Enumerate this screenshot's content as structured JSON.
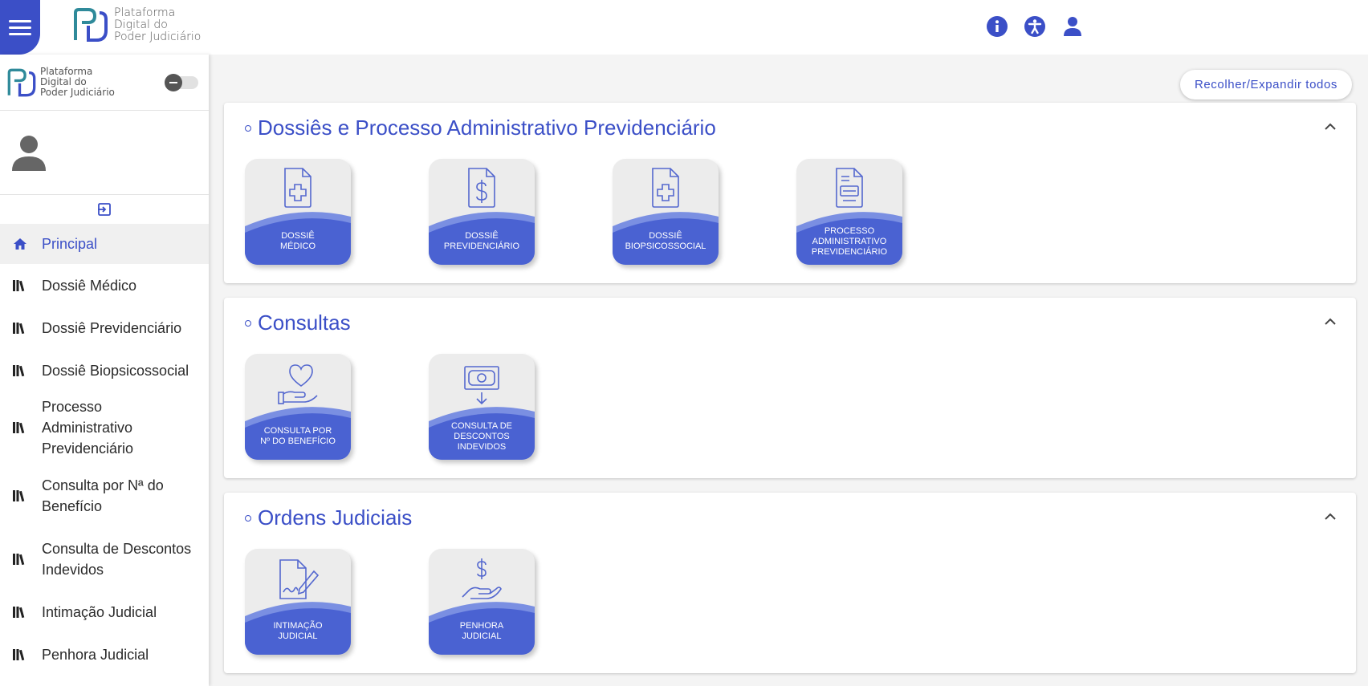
{
  "header": {
    "logo_lines": [
      "Plataforma",
      "Digital do",
      "Poder Judiciário"
    ],
    "icons": [
      "info-icon",
      "accessibility-icon",
      "user-icon"
    ]
  },
  "sidebar": {
    "logo_lines": [
      "Plataforma",
      "Digital do",
      "Poder Judiciário"
    ],
    "items": [
      {
        "label": "Principal",
        "icon": "home-icon",
        "active": true
      },
      {
        "label": "Dossiê Médico",
        "icon": "library-icon"
      },
      {
        "label": "Dossiê Previdenciário",
        "icon": "library-icon"
      },
      {
        "label": "Dossiê Biopsicossocial",
        "icon": "library-icon"
      },
      {
        "label": "Processo Administrativo Previdenciário",
        "icon": "library-icon"
      },
      {
        "label": "Consulta por Nª do Benefício",
        "icon": "library-icon"
      },
      {
        "label": "Consulta de Descontos Indevidos",
        "icon": "library-icon"
      },
      {
        "label": "Intimação Judicial",
        "icon": "library-icon"
      },
      {
        "label": "Penhora Judicial",
        "icon": "library-icon"
      }
    ]
  },
  "main": {
    "collapse_all_label": "Recolher/Expandir todos",
    "sections": [
      {
        "title": "Dossiês e Processo Administrativo Previdenciário",
        "cards": [
          {
            "label": "DOSSIÊ\nMÉDICO",
            "icon": "medical-document-icon"
          },
          {
            "label": "DOSSIÊ\nPREVIDENCIÁRIO",
            "icon": "money-document-icon"
          },
          {
            "label": "DOSSIÊ\nBIOPSICOSSOCIAL",
            "icon": "medical-document-icon"
          },
          {
            "label": "PROCESSO\nADMINISTRATIVO\nPREVIDENCIÁRIO",
            "icon": "form-document-icon"
          }
        ]
      },
      {
        "title": "Consultas",
        "cards": [
          {
            "label": "CONSULTA POR\nNº DO BENEFÍCIO",
            "icon": "heart-hand-icon"
          },
          {
            "label": "CONSULTA DE\nDESCONTOS\nINDEVIDOS",
            "icon": "cash-down-icon"
          }
        ]
      },
      {
        "title": "Ordens Judiciais",
        "cards": [
          {
            "label": "INTIMAÇÃO\nJUDICIAL",
            "icon": "signed-document-icon"
          },
          {
            "label": "PENHORA\nJUDICIAL",
            "icon": "money-hand-icon"
          }
        ]
      }
    ]
  },
  "colors": {
    "accent": "#3b4fc7",
    "card_wave": "#4a62d2",
    "card_wave_light": "#7a8fe2"
  }
}
